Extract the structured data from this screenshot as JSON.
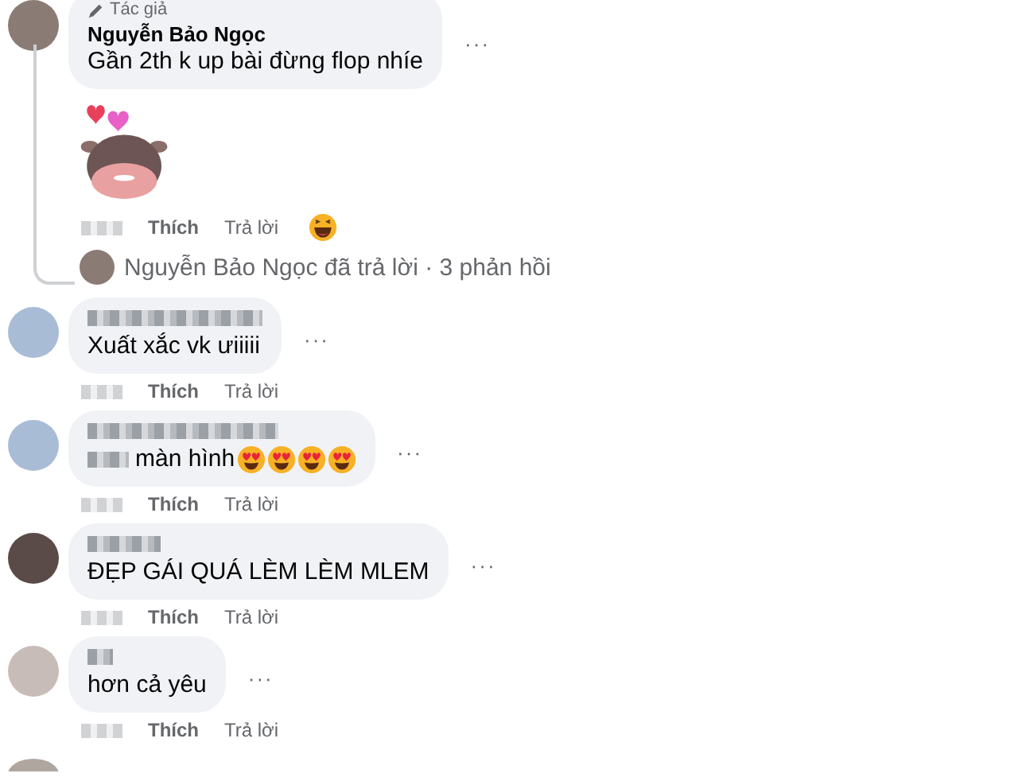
{
  "author_comment": {
    "badge": "Tác giả",
    "name": "Nguyễn Bảo Ngọc",
    "text": "Gần 2th k up bài đừng flop nhíe",
    "more": "···",
    "like": "Thích",
    "reply": "Trả lời"
  },
  "replies_summary": "Nguyễn Bảo Ngọc đã trả lời · 3 phản hồi",
  "comments": [
    {
      "kind": "plain",
      "text": "Xuất xắc vk ưiiiii",
      "more": "···",
      "like": "Thích",
      "reply": "Trả lời"
    },
    {
      "kind": "emoji",
      "text": "màn hình",
      "more": "···",
      "like": "Thích",
      "reply": "Trả lời"
    },
    {
      "kind": "plain",
      "text": "ĐẸP GÁI QUÁ LÈM LÈM MLEM",
      "more": "···",
      "like": "Thích",
      "reply": "Trả lời"
    },
    {
      "kind": "plain",
      "text": "hơn cả yêu",
      "more": "···",
      "like": "Thích",
      "reply": "Trả lời"
    }
  ]
}
